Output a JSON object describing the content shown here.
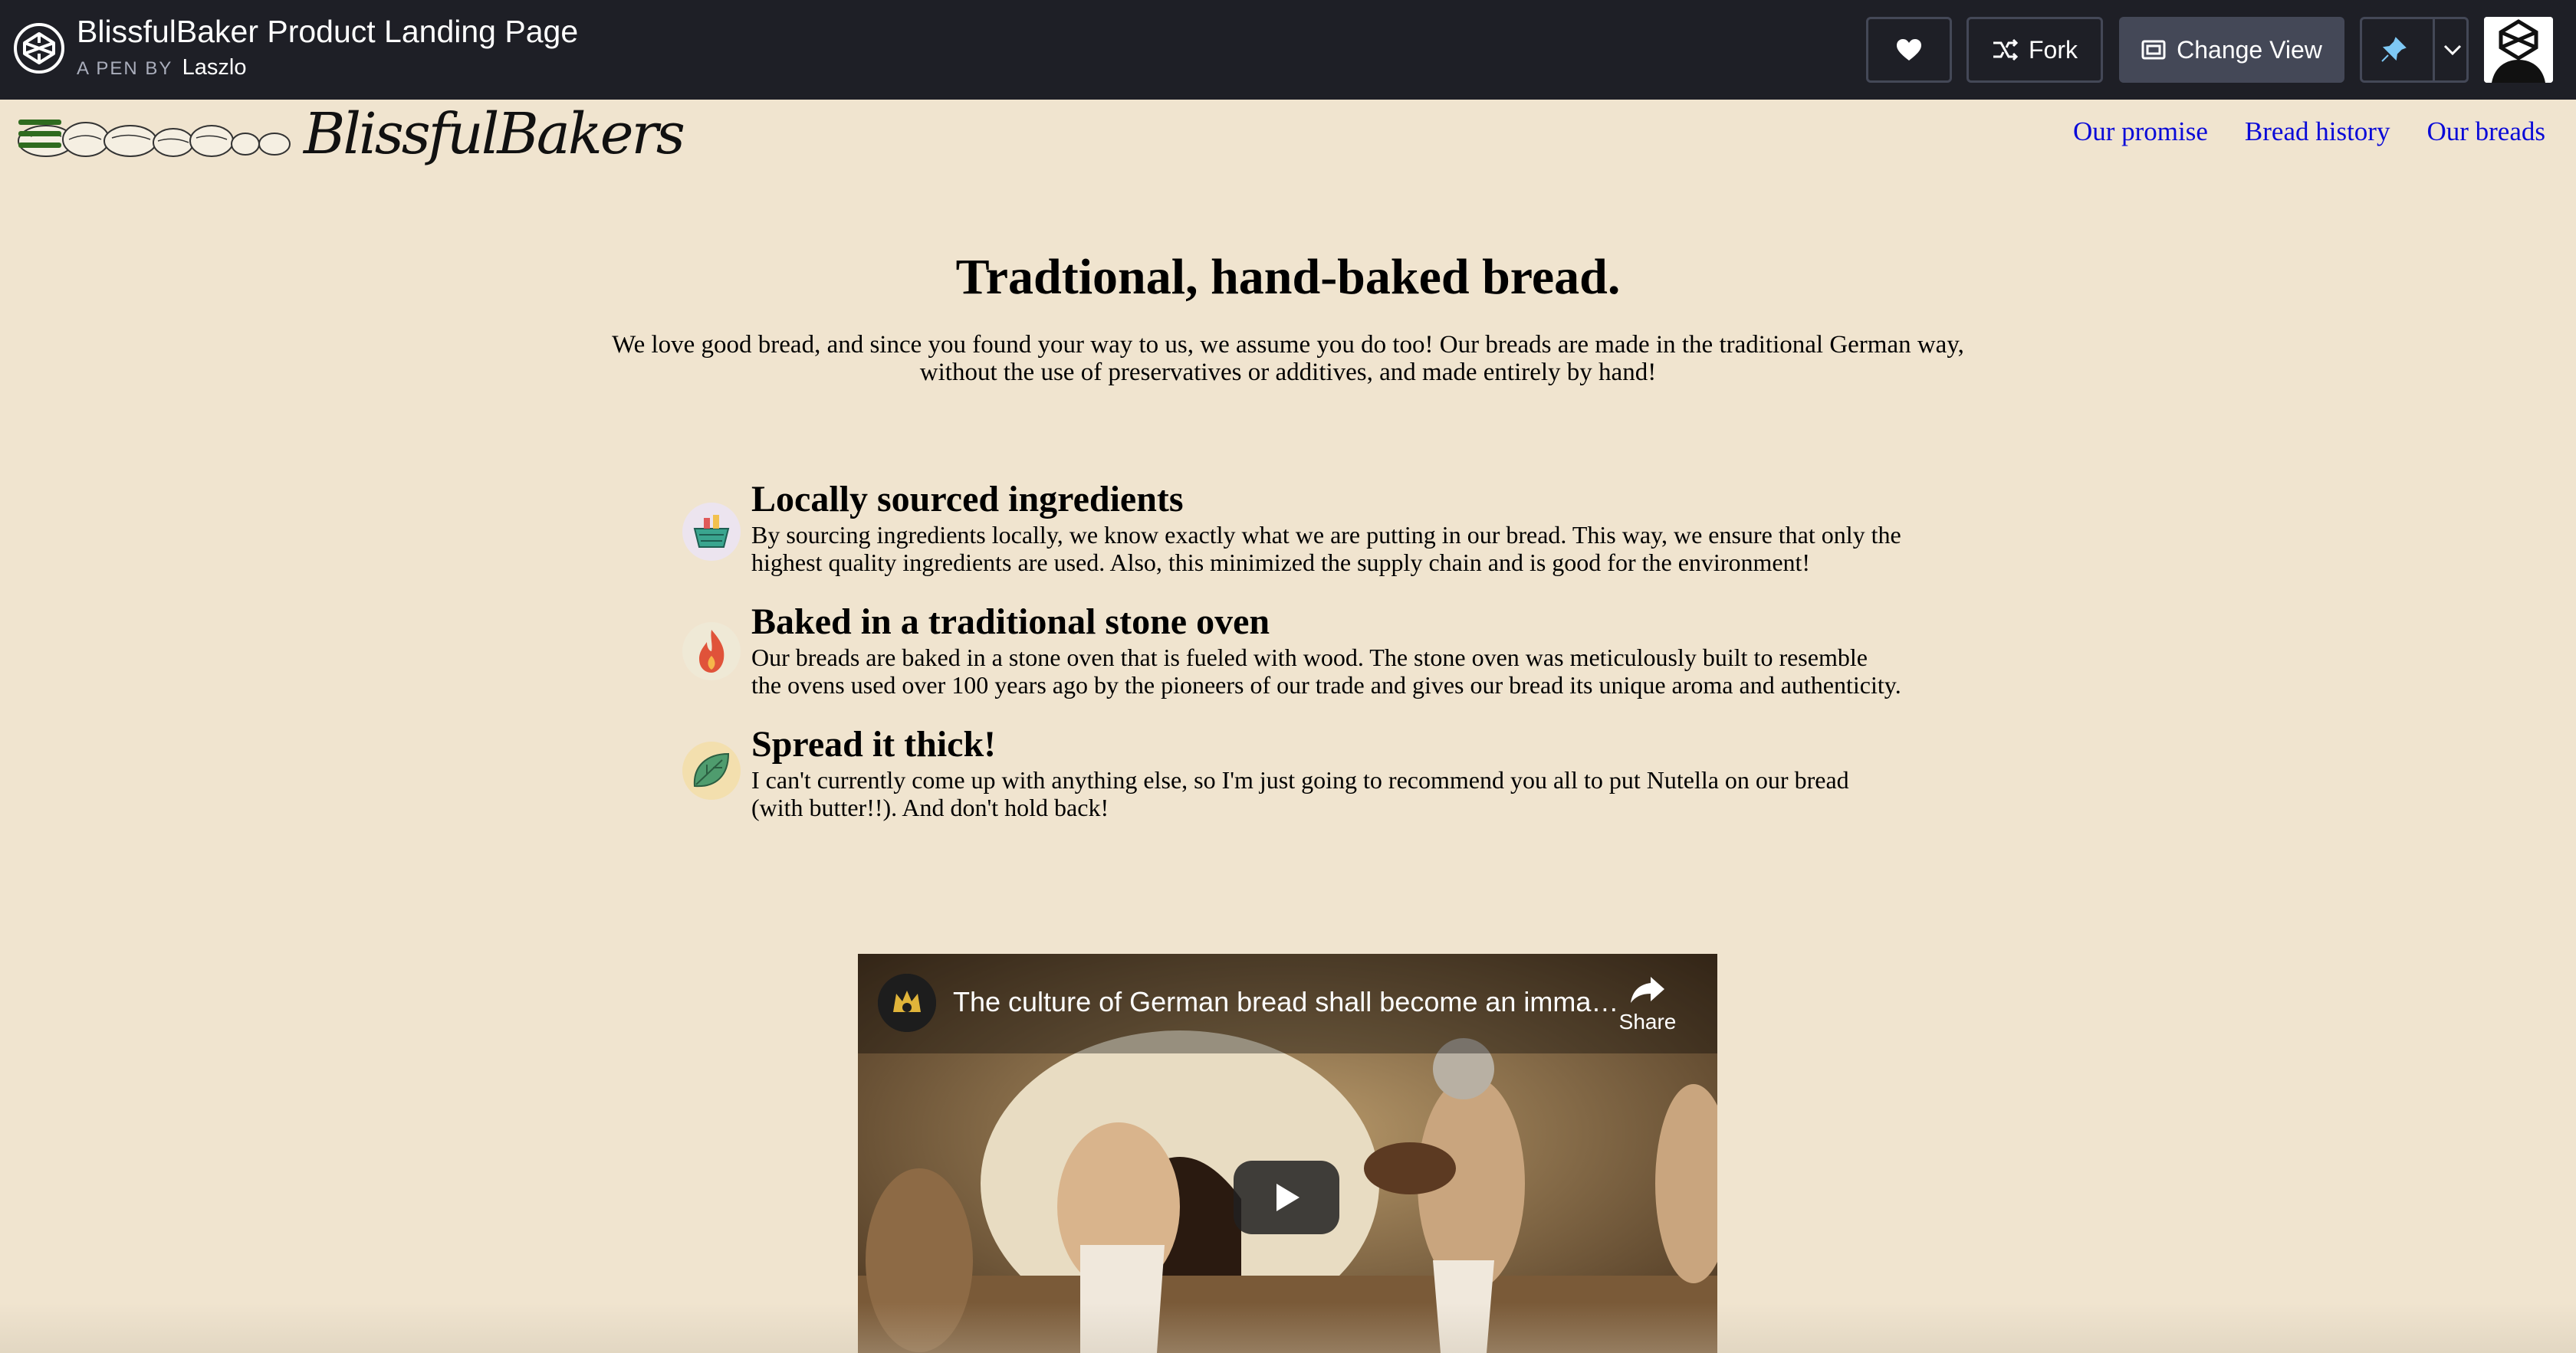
{
  "codepen": {
    "title": "BlissfulBaker Product Landing Page",
    "byline": "A PEN BY",
    "author": "Laszlo",
    "fork_label": "Fork",
    "change_view_label": "Change View",
    "icons": [
      "codepen-logo-icon",
      "heart-icon",
      "fork-icon",
      "change-view-icon",
      "pin-icon",
      "chevron-down-icon",
      "user-avatar"
    ]
  },
  "header": {
    "brand": "BlissfulBakers",
    "nav": [
      {
        "label": "Our promise"
      },
      {
        "label": "Bread history"
      },
      {
        "label": "Our breads"
      }
    ]
  },
  "hero": {
    "title": "Tradtional, hand-baked bread.",
    "text": "We love good bread, and since you found your way to us, we assume you do too! Our breads are made in the traditional German way, without the use of preservatives or additives, and made entirely by hand!"
  },
  "features": [
    {
      "icon": "basket-icon",
      "title": "Locally sourced ingredients",
      "text": "By sourcing ingredients locally, we know exactly what we are putting in our bread. This way, we ensure that only the highest quality ingredients are used. Also, this minimized the supply chain and is good for the environment!"
    },
    {
      "icon": "fire-icon",
      "title": "Baked in a traditional stone oven",
      "text": "Our breads are baked in a stone oven that is fueled with wood. The stone oven was meticulously built to resemble the ovens used over 100 years ago by the pioneers of our trade and gives our bread its unique aroma and authenticity."
    },
    {
      "icon": "leaf-icon",
      "title": "Spread it thick!",
      "text": "I can't currently come up with anything else, so I'm just going to recommend you all to put Nutella on our bread (with butter!!). And don't hold back!"
    }
  ],
  "video": {
    "title": "The culture of German bread shall become an imma…",
    "share_label": "Share"
  },
  "colors": {
    "page_bg": "#f0e4cf",
    "topbar_bg": "#1e1f26",
    "nav_link": "#0a0ad8"
  }
}
